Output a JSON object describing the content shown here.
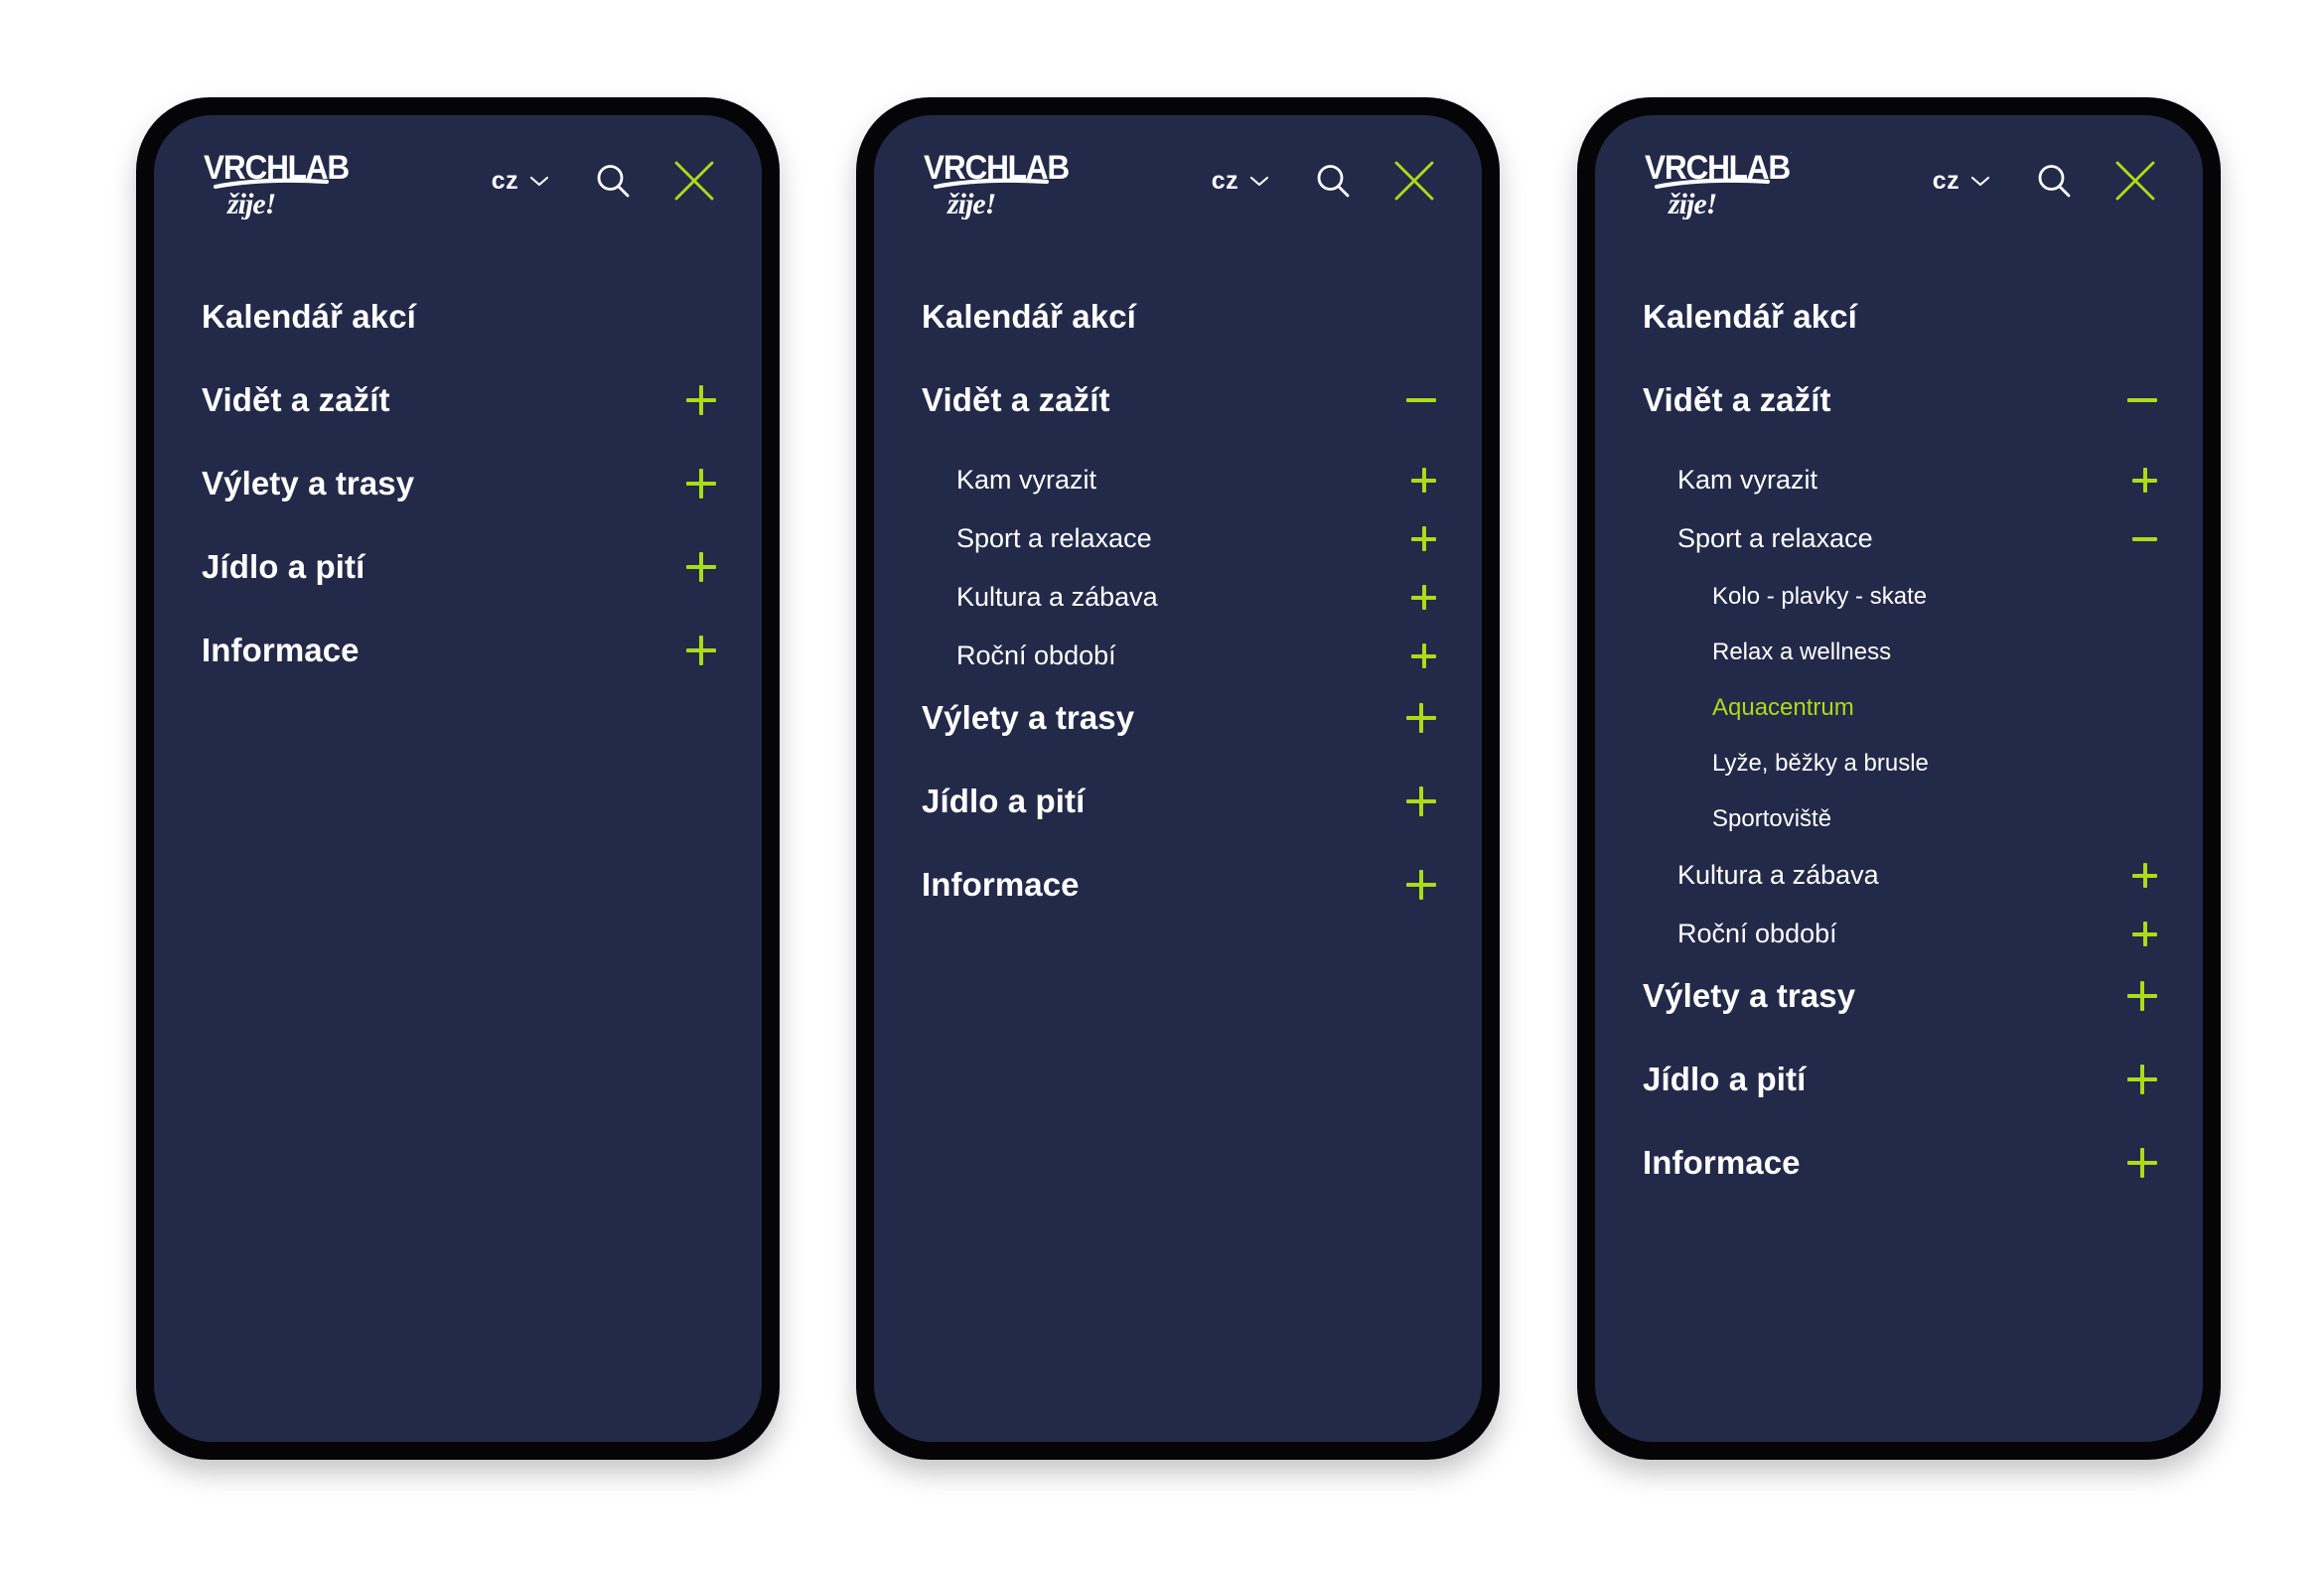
{
  "brand": {
    "logo_top": "VRCHLABÍ",
    "logo_script": "žije!",
    "accent_color": "#aadc17",
    "screen_bg": "#232949",
    "frame_color": "#050507",
    "page_bg": "#ffffff"
  },
  "header": {
    "lang_label": "cz",
    "chevron_icon": "chevron-down-icon",
    "search_icon": "search-icon",
    "close_icon": "close-icon"
  },
  "screens": [
    {
      "state": "collapsed",
      "items": [
        {
          "label": "Kalendář akcí",
          "level": 1,
          "toggle": "none"
        },
        {
          "label": "Vidět a zažít",
          "level": 1,
          "toggle": "plus"
        },
        {
          "label": "Výlety a trasy",
          "level": 1,
          "toggle": "plus"
        },
        {
          "label": "Jídlo a pití",
          "level": 1,
          "toggle": "plus"
        },
        {
          "label": "Informace",
          "level": 1,
          "toggle": "plus"
        }
      ]
    },
    {
      "state": "level-2-expanded",
      "items": [
        {
          "label": "Kalendář akcí",
          "level": 1,
          "toggle": "none"
        },
        {
          "label": "Vidět a zažít",
          "level": 1,
          "toggle": "minus"
        },
        {
          "label": "Kam vyrazit",
          "level": 2,
          "toggle": "plus"
        },
        {
          "label": "Sport a relaxace",
          "level": 2,
          "toggle": "plus"
        },
        {
          "label": "Kultura a zábava",
          "level": 2,
          "toggle": "plus"
        },
        {
          "label": "Roční období",
          "level": 2,
          "toggle": "plus"
        },
        {
          "label": "Výlety a trasy",
          "level": 1,
          "toggle": "plus"
        },
        {
          "label": "Jídlo a pití",
          "level": 1,
          "toggle": "plus"
        },
        {
          "label": "Informace",
          "level": 1,
          "toggle": "plus"
        }
      ]
    },
    {
      "state": "level-3-expanded",
      "items": [
        {
          "label": "Kalendář akcí",
          "level": 1,
          "toggle": "none"
        },
        {
          "label": "Vidět a zažít",
          "level": 1,
          "toggle": "minus"
        },
        {
          "label": "Kam vyrazit",
          "level": 2,
          "toggle": "plus"
        },
        {
          "label": "Sport a relaxace",
          "level": 2,
          "toggle": "minus"
        },
        {
          "label": "Kolo - plavky - skate",
          "level": 3,
          "toggle": "none"
        },
        {
          "label": "Relax a wellness",
          "level": 3,
          "toggle": "none"
        },
        {
          "label": "Aquacentrum",
          "level": 3,
          "toggle": "none",
          "active": true
        },
        {
          "label": "Lyže, běžky a brusle",
          "level": 3,
          "toggle": "none"
        },
        {
          "label": "Sportoviště",
          "level": 3,
          "toggle": "none"
        },
        {
          "label": "Kultura a zábava",
          "level": 2,
          "toggle": "plus"
        },
        {
          "label": "Roční období",
          "level": 2,
          "toggle": "plus"
        },
        {
          "label": "Výlety a trasy",
          "level": 1,
          "toggle": "plus"
        },
        {
          "label": "Jídlo a pití",
          "level": 1,
          "toggle": "plus"
        },
        {
          "label": "Informace",
          "level": 1,
          "toggle": "plus"
        }
      ]
    }
  ]
}
